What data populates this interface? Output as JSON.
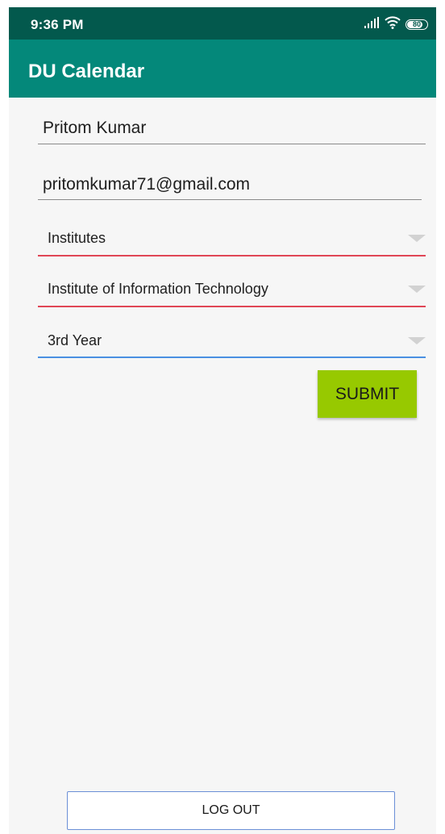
{
  "status_bar": {
    "time": "9:36 PM",
    "battery_level": "80",
    "icons": [
      "signal-icon",
      "wifi-icon",
      "battery-icon"
    ]
  },
  "app_bar": {
    "title": "DU Calendar"
  },
  "form": {
    "name_value": "Pritom Kumar",
    "email_value": "pritomkumar71@gmail.com",
    "faculty_spinner": {
      "selected": "Institutes",
      "underline_color": "#e04656"
    },
    "department_spinner": {
      "selected": "Institute of Information Technology",
      "underline_color": "#e04656"
    },
    "year_spinner": {
      "selected": "3rd Year",
      "underline_color": "#4a90e2"
    },
    "submit_label": "SUBMIT"
  },
  "footer": {
    "logout_label": "LOG OUT"
  },
  "colors": {
    "status_bar": "#03594d",
    "app_bar": "#04887a",
    "submit_button": "#97c900",
    "background": "#f6f6f6"
  }
}
